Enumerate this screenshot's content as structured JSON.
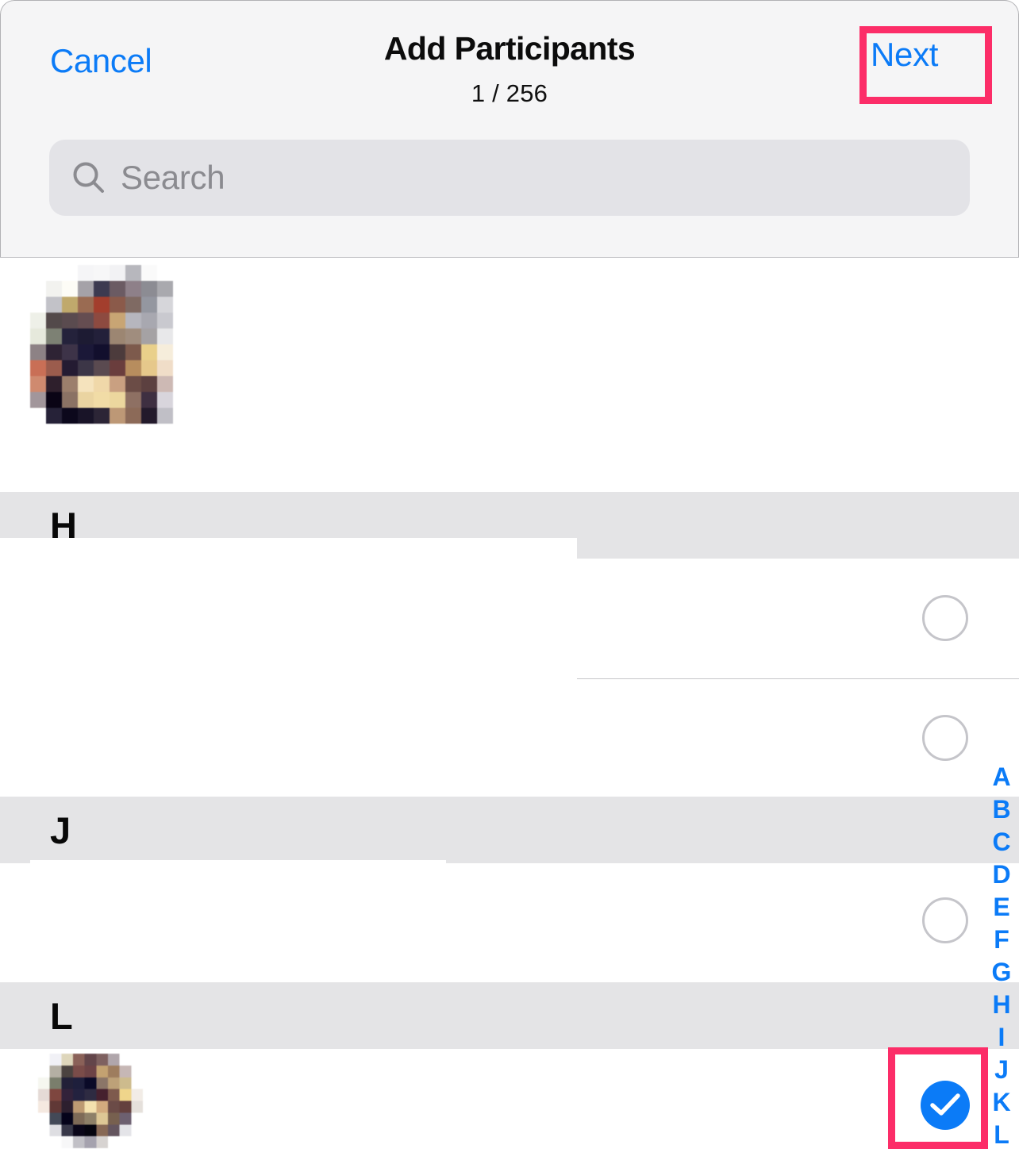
{
  "nav": {
    "cancel_label": "Cancel",
    "title": "Add Participants",
    "subtitle": "1 / 256",
    "next_label": "Next"
  },
  "search": {
    "placeholder": "Search",
    "value": "",
    "icon": "search-icon"
  },
  "list": {
    "selected_contact": {
      "name": "",
      "avatar": "pixelated-redacted-photo",
      "checkbox": "hidden"
    },
    "sections": [
      {
        "letter": "H",
        "rows": [
          {
            "name": "",
            "avatar": "redacted",
            "checkbox_state": "unselected"
          },
          {
            "name": "",
            "avatar": "redacted",
            "checkbox_state": "unselected"
          }
        ]
      },
      {
        "letter": "J",
        "rows": [
          {
            "name": "",
            "avatar": "redacted",
            "checkbox_state": "unselected"
          }
        ]
      },
      {
        "letter": "L",
        "rows": [
          {
            "name": "",
            "avatar": "pixelated-redacted-photo",
            "checkbox_state": "selected"
          }
        ]
      }
    ]
  },
  "alphabet_index": {
    "letters": [
      "A",
      "B",
      "C",
      "D",
      "E",
      "F",
      "G",
      "H",
      "I",
      "J",
      "K",
      "L"
    ]
  },
  "annotations": {
    "color": "#FC2D68",
    "targets": [
      "next-button",
      "selected-contact-checkbox"
    ]
  },
  "colors": {
    "accent_blue": "#0B7BF7",
    "nav_background": "#F5F5F6",
    "search_background": "#E3E3E7",
    "section_header_background": "#E4E4E6",
    "separator": "#C6C6C8",
    "checkbox_unselected_border": "#C5C5CA",
    "annotation_pink": "#FC2D68"
  }
}
